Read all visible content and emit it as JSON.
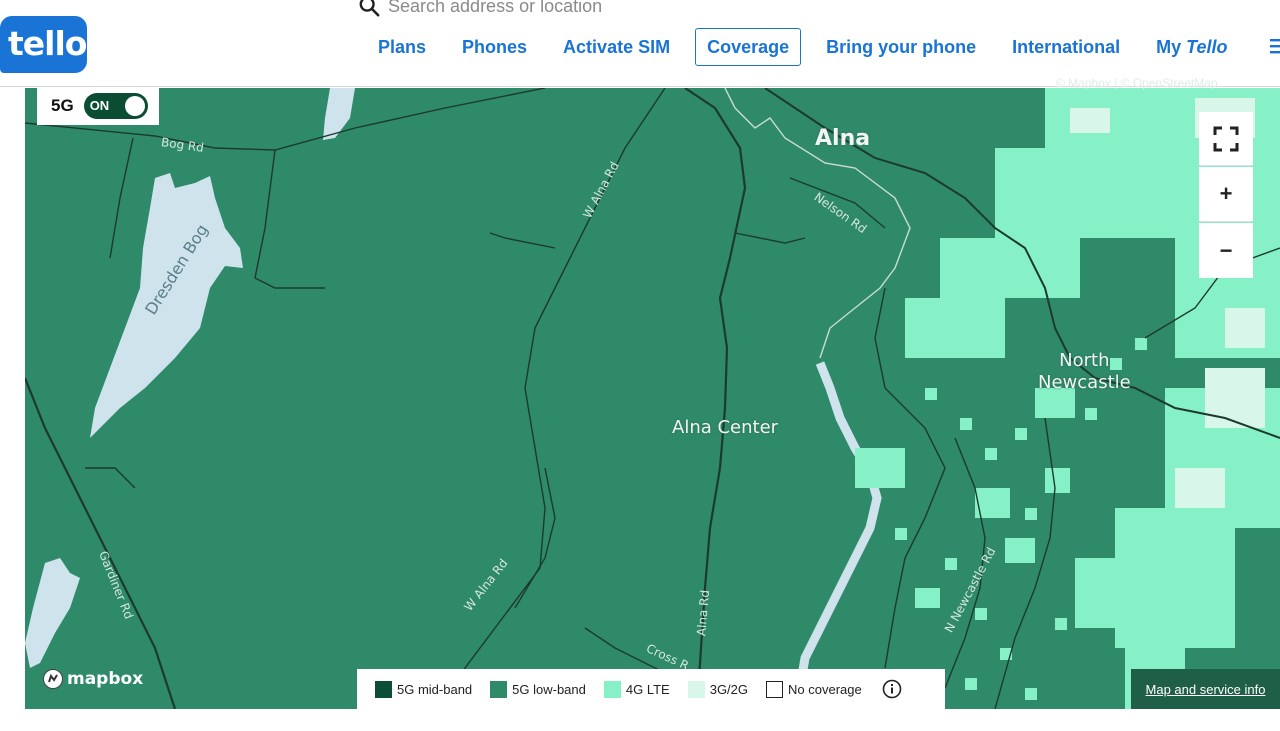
{
  "header": {
    "logo_text": "tello",
    "search": {
      "placeholder": "Search address or location"
    },
    "nav": [
      {
        "label": "Plans"
      },
      {
        "label": "Phones"
      },
      {
        "label": "Activate SIM"
      },
      {
        "label": "Coverage",
        "active": true
      },
      {
        "label": "Bring your phone"
      },
      {
        "label": "International"
      },
      {
        "label_prefix": "My ",
        "label_brand": "Tello"
      }
    ],
    "accent_color": "#1a74d6"
  },
  "map": {
    "toggle": {
      "label": "5G",
      "state": "ON"
    },
    "attribution": "© Mapbox  |  © OpenStreetMap",
    "places": {
      "alna": "Alna",
      "alna_center": "Alna Center",
      "north_newcastle": "North\nNewcastle",
      "dresden_bog": "Dresden Bog"
    },
    "roads": {
      "bog_rd": "Bog Rd",
      "w_alna_rd_1": "W Alna Rd",
      "w_alna_rd_2": "W Alna Rd",
      "nelson_rd": "Nelson Rd",
      "alna_rd": "Alna Rd",
      "gardiner_rd": "Gardiner Rd",
      "n_newcastle_rd": "N Newcastle Rd",
      "cross_rd": "Cross R"
    },
    "controls": {
      "fullscreen_icon": "fullscreen-icon",
      "zoom_in": "+",
      "zoom_out": "−"
    },
    "mapbox_logo": "mapbox",
    "legend": [
      {
        "label": "5G mid-band",
        "color": "#0b4d36",
        "outlined": false
      },
      {
        "label": "5G low-band",
        "color": "#2e8a69",
        "outlined": false
      },
      {
        "label": "4G LTE",
        "color": "#86f0c6",
        "outlined": false
      },
      {
        "label": "3G/2G",
        "color": "#d8f6ea",
        "outlined": false
      },
      {
        "label": "No coverage",
        "color": "#ffffff",
        "outlined": true
      }
    ],
    "map_info_link": "Map and service info"
  }
}
